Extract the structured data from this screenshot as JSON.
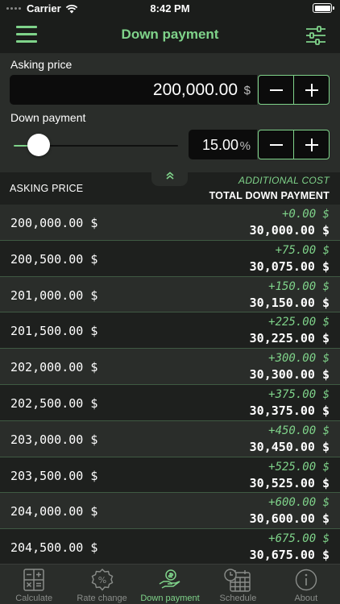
{
  "status_bar": {
    "carrier": "Carrier",
    "time": "8:42 PM"
  },
  "nav": {
    "title": "Down payment",
    "menu_icon": "hamburger-menu-icon",
    "settings_icon": "sliders-icon"
  },
  "asking_price": {
    "label": "Asking price",
    "value": "200,000.00",
    "unit": "$"
  },
  "down_payment": {
    "label": "Down payment",
    "value": "15.00",
    "unit": "%",
    "slider_fraction": 0.15
  },
  "table": {
    "header_left": "ASKING PRICE",
    "header_additional": "ADDITIONAL COST",
    "header_total": "TOTAL DOWN PAYMENT",
    "rows": [
      {
        "price": "200,000.00 $",
        "additional": "+0.00 $",
        "total": "30,000.00 $"
      },
      {
        "price": "200,500.00 $",
        "additional": "+75.00 $",
        "total": "30,075.00 $"
      },
      {
        "price": "201,000.00 $",
        "additional": "+150.00 $",
        "total": "30,150.00 $"
      },
      {
        "price": "201,500.00 $",
        "additional": "+225.00 $",
        "total": "30,225.00 $"
      },
      {
        "price": "202,000.00 $",
        "additional": "+300.00 $",
        "total": "30,300.00 $"
      },
      {
        "price": "202,500.00 $",
        "additional": "+375.00 $",
        "total": "30,375.00 $"
      },
      {
        "price": "203,000.00 $",
        "additional": "+450.00 $",
        "total": "30,450.00 $"
      },
      {
        "price": "203,500.00 $",
        "additional": "+525.00 $",
        "total": "30,525.00 $"
      },
      {
        "price": "204,000.00 $",
        "additional": "+600.00 $",
        "total": "30,600.00 $"
      },
      {
        "price": "204,500.00 $",
        "additional": "+675.00 $",
        "total": "30,675.00 $"
      }
    ]
  },
  "tabs": [
    {
      "label": "Calculate",
      "icon": "calculator-icon",
      "active": false
    },
    {
      "label": "Rate change",
      "icon": "percent-badge-icon",
      "active": false
    },
    {
      "label": "Down payment",
      "icon": "hand-money-icon",
      "active": true
    },
    {
      "label": "Schedule",
      "icon": "calendar-clock-icon",
      "active": false
    },
    {
      "label": "About",
      "icon": "info-icon",
      "active": false
    }
  ],
  "colors": {
    "accent": "#7fd38a",
    "background": "#1e201e",
    "panel": "#2a2d2a",
    "field": "#0c0c0c"
  }
}
